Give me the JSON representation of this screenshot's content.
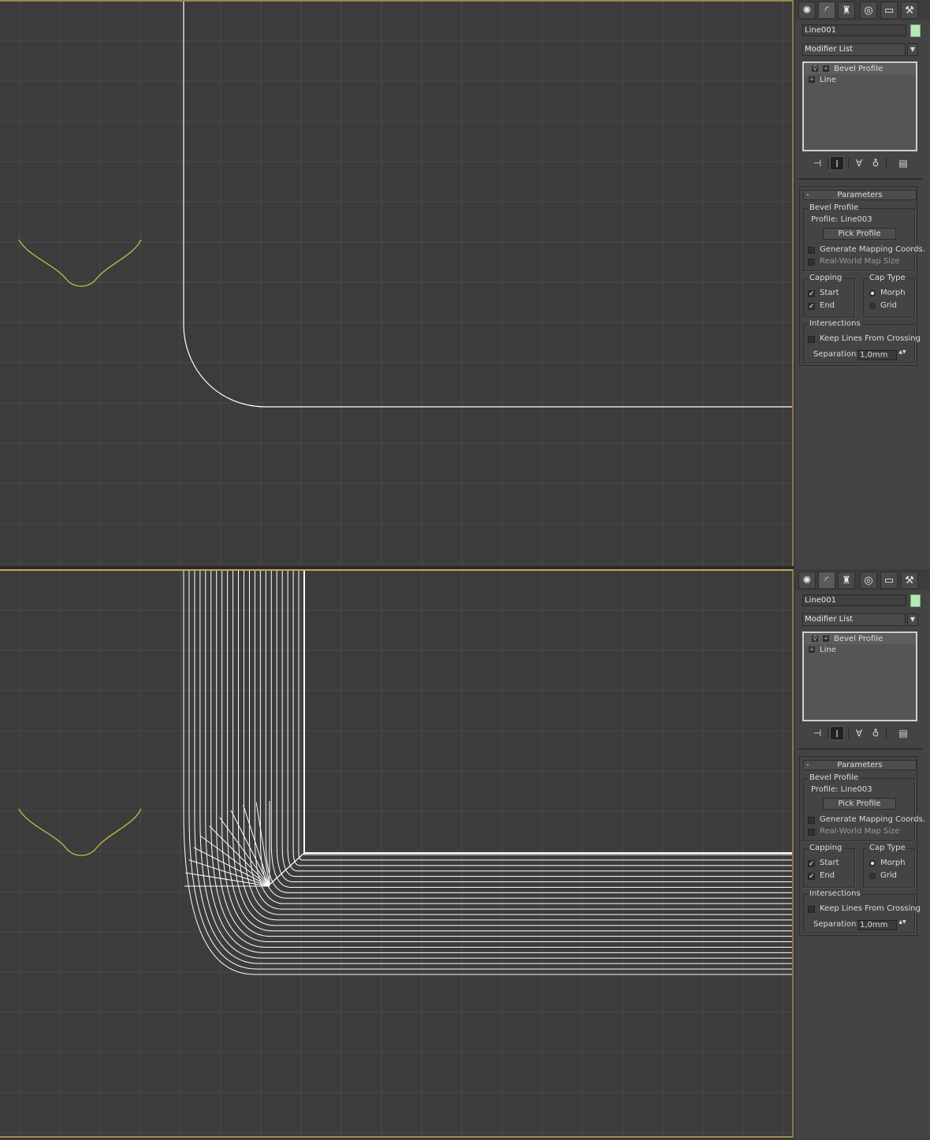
{
  "colors": {
    "viewport_bg": "#3c3c3c",
    "grid_line": "#4a4a4a",
    "spline": "#ffffff",
    "profile_curve": "#c8c23a",
    "viewport_border": "#c8a84e",
    "panel_bg": "#444444",
    "swatch": "#b4e8b4"
  },
  "command_tabs": [
    {
      "icon": "create-icon",
      "glyph": "✺"
    },
    {
      "icon": "modify-icon",
      "glyph": "◜"
    },
    {
      "icon": "hierarchy-icon",
      "glyph": "♜"
    },
    {
      "icon": "motion-icon",
      "glyph": "◎"
    },
    {
      "icon": "display-icon",
      "glyph": "▭"
    },
    {
      "icon": "utilities-icon",
      "glyph": "⚒"
    }
  ],
  "object_name": "Line001",
  "modifier_list_label": "Modifier List",
  "modifier_stack": [
    "Bevel Profile",
    "Line"
  ],
  "stack_tools": [
    {
      "icon": "pin-stack-icon",
      "glyph": "⊣"
    },
    {
      "icon": "show-end-result-icon",
      "glyph": "Ι"
    },
    {
      "icon": "make-unique-icon",
      "glyph": "∀"
    },
    {
      "icon": "remove-modifier-icon",
      "glyph": "♁"
    },
    {
      "icon": "configure-modifier-sets-icon",
      "glyph": "▤"
    }
  ],
  "parameters": {
    "rollout_title": "Parameters",
    "collapse_glyph": "-",
    "bevel_profile_group": "Bevel Profile",
    "profile_label": "Profile: Line003",
    "pick_profile_button": "Pick Profile",
    "generate_mapping": "Generate Mapping Coords.",
    "real_world_map": "Real-World Map Size",
    "capping_group": "Capping",
    "cap_start": "Start",
    "cap_end": "End",
    "cap_type_group": "Cap Type",
    "cap_morph": "Morph",
    "cap_grid": "Grid",
    "intersections_group": "Intersections",
    "keep_lines": "Keep Lines From Crossing",
    "separation_label": "Separation:",
    "separation_value": "1,0mm",
    "check_glyph": "✓",
    "spin_glyph": "▲▼"
  },
  "dropdown_glyph": "▼"
}
